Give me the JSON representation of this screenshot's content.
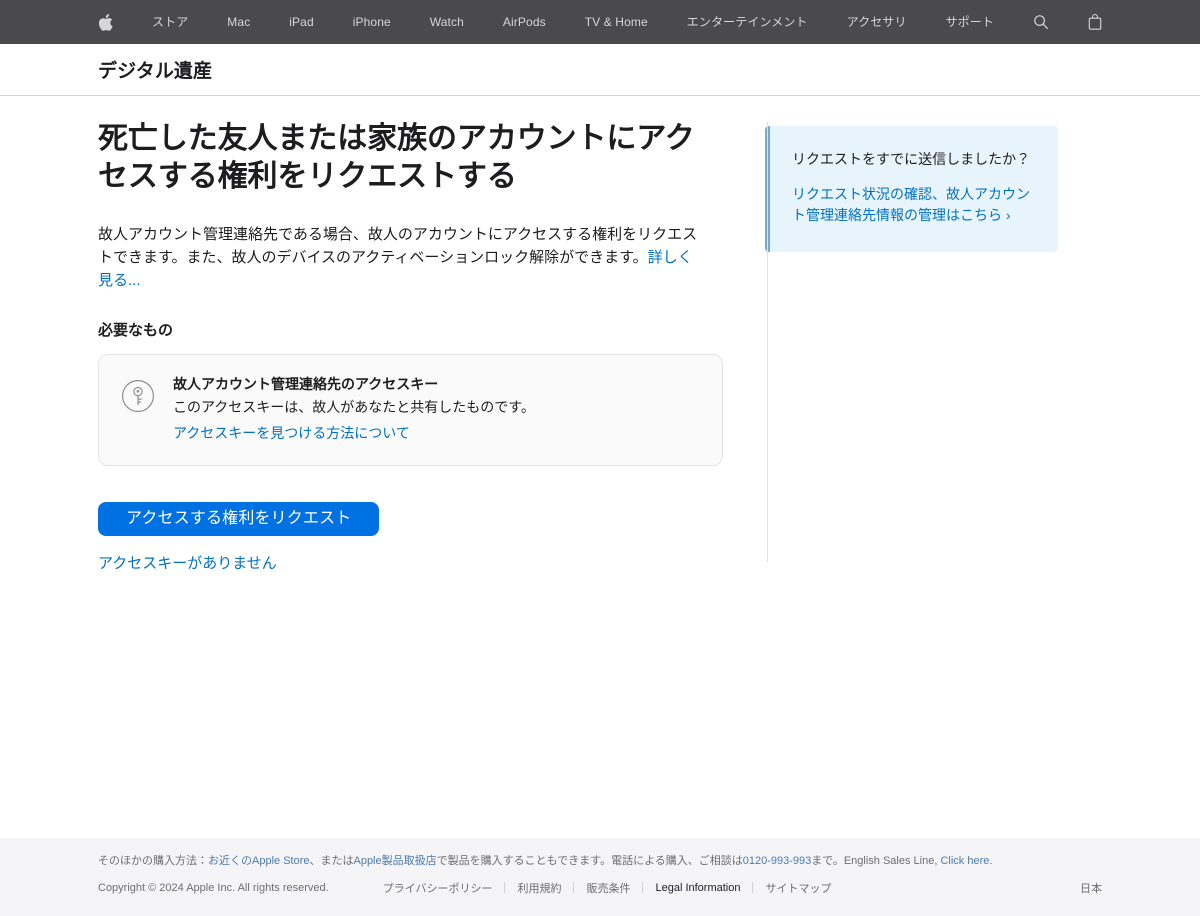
{
  "globalnav": {
    "items": [
      {
        "label": "",
        "icon": "apple-logo-icon"
      },
      {
        "label": "ストア",
        "icon": ""
      },
      {
        "label": "Mac",
        "icon": ""
      },
      {
        "label": "iPad",
        "icon": ""
      },
      {
        "label": "iPhone",
        "icon": ""
      },
      {
        "label": "Watch",
        "icon": ""
      },
      {
        "label": "AirPods",
        "icon": ""
      },
      {
        "label": "TV & Home",
        "icon": ""
      },
      {
        "label": "エンターテインメント",
        "icon": ""
      },
      {
        "label": "アクセサリ",
        "icon": ""
      },
      {
        "label": "サポート",
        "icon": ""
      },
      {
        "label": "",
        "icon": "search-icon"
      },
      {
        "label": "",
        "icon": "shopping-bag-icon"
      }
    ],
    "background": "#4a4a4c",
    "text_color": "#d6d6d6"
  },
  "localnav": {
    "title": "デジタル遺産"
  },
  "main": {
    "headline": "死亡した友人または家族のアカウントにアクセスする権利をリクエストする",
    "intro_text": "故人アカウント管理連絡先である場合、故人のアカウントにアクセスする権利をリクエストできます。また、故人のデバイスのアクティベーションロック解除ができます。",
    "intro_link": "詳しく見る...",
    "subhead": "必要なもの",
    "requirement_card": {
      "icon": "key-circle-icon",
      "title": "故人アカウント管理連絡先のアクセスキー",
      "description": "このアクセスキーは、故人があなたと共有したものです。",
      "link": "アクセスキーを見つける方法について"
    },
    "cta_label": "アクセスする権利をリクエスト",
    "cta_color": "#0071e3",
    "secondary_link": "アクセスキーがありません"
  },
  "sidebar": {
    "callout": {
      "title": "リクエストをすでに送信しましたか？",
      "link": "リクエスト状況の確認、故人アカウント管理連絡先情報の管理はこちら ›",
      "background": "#e8f4fb",
      "accent": "#7aa9d0"
    }
  },
  "footer": {
    "sosumi": {
      "part1": "そのほかの購入方法：",
      "link1": "お近くのApple Store",
      "part2": "、または",
      "link2": "Apple製品取扱店",
      "part3": "で製品を購入することもできます。電話による購入、ご相談は",
      "link3": "0120-993-993",
      "part4": "まで。English Sales Line, ",
      "link4": "Click here",
      "part5": "."
    },
    "copyright": "Copyright © 2024 Apple Inc. All rights reserved.",
    "links": [
      {
        "label": "プライバシーポリシー",
        "current": false
      },
      {
        "label": "利用規約",
        "current": false
      },
      {
        "label": "販売条件",
        "current": false
      },
      {
        "label": "Legal Information",
        "current": true
      },
      {
        "label": "サイトマップ",
        "current": false
      }
    ],
    "locale": "日本"
  }
}
